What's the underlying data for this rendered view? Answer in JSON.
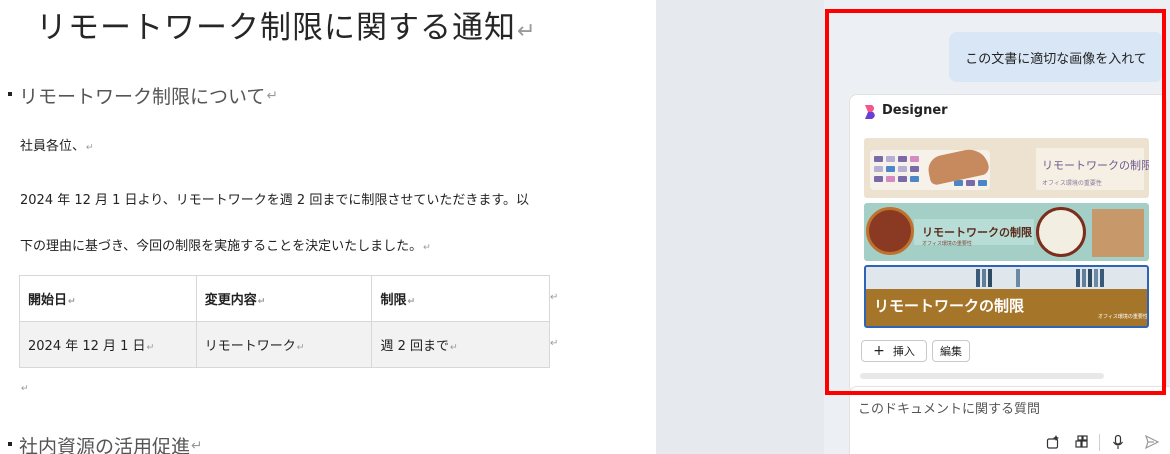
{
  "document": {
    "title": "リモートワーク制限に関する通知",
    "heading1": "リモートワーク制限について",
    "greeting": "社員各位、",
    "body_line1": "2024 年 12 月 1 日より、リモートワークを週 2 回までに制限させていただきます。以",
    "body_line2": "下の理由に基づき、今回の制限を実施することを決定いたしました。",
    "table": {
      "headers": [
        "開始日",
        "変更内容",
        "制限"
      ],
      "rows": [
        [
          "2024 年 12 月 1 日",
          "リモートワーク",
          "週 2 回まで"
        ]
      ]
    },
    "heading2": "社内資源の活用促進",
    "paragraph_mark": "↵"
  },
  "copilot": {
    "user_message": "この文書に適切な画像を入れて",
    "designer_title": "Designer",
    "images": [
      {
        "title": "リモートワークの制限",
        "subtitle": "オフィス環境の重要性"
      },
      {
        "title": "リモートワークの制限",
        "subtitle": "オフィス環境の重要性"
      },
      {
        "title": "リモートワークの制限",
        "subtitle": "オフィス環境の重要性"
      }
    ],
    "insert_icon": "+",
    "insert_label": "挿入",
    "edit_label": "編集",
    "input_placeholder": "このドキュメントに関する質問",
    "toolbar_icons": [
      "prompt-guide-icon",
      "attach-apps-icon",
      "microphone-icon",
      "send-icon"
    ],
    "highlight_color": "#ff0000",
    "user_bubble_color": "#d9e6f6",
    "selected_image_border": "#2f63b5"
  }
}
